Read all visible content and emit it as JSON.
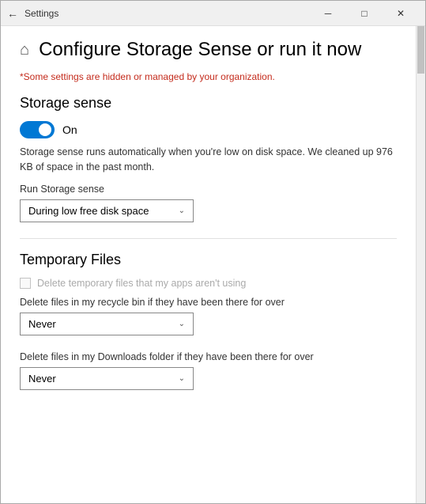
{
  "window": {
    "title": "Settings",
    "back_icon": "←",
    "minimize_icon": "─",
    "maximize_icon": "□",
    "close_icon": "✕"
  },
  "header": {
    "home_icon": "⌂",
    "title": "Configure Storage Sense or run it now"
  },
  "org_notice": "*Some settings are hidden or managed by your organization.",
  "storage_sense": {
    "section_title": "Storage sense",
    "toggle_label": "On",
    "description": "Storage sense runs automatically when you're low on disk space. We cleaned up 976 KB of space in the past month.",
    "run_label": "Run Storage sense",
    "dropdown_value": "During low free disk space"
  },
  "temporary_files": {
    "section_title": "Temporary Files",
    "checkbox_label": "Delete temporary files that my apps aren't using",
    "recycle_label": "Delete files in my recycle bin if they have been there for over",
    "recycle_dropdown": "Never",
    "downloads_label": "Delete files in my Downloads folder if they have been there for over",
    "downloads_dropdown": "Never"
  },
  "icons": {
    "dropdown_arrow": "⌄"
  }
}
